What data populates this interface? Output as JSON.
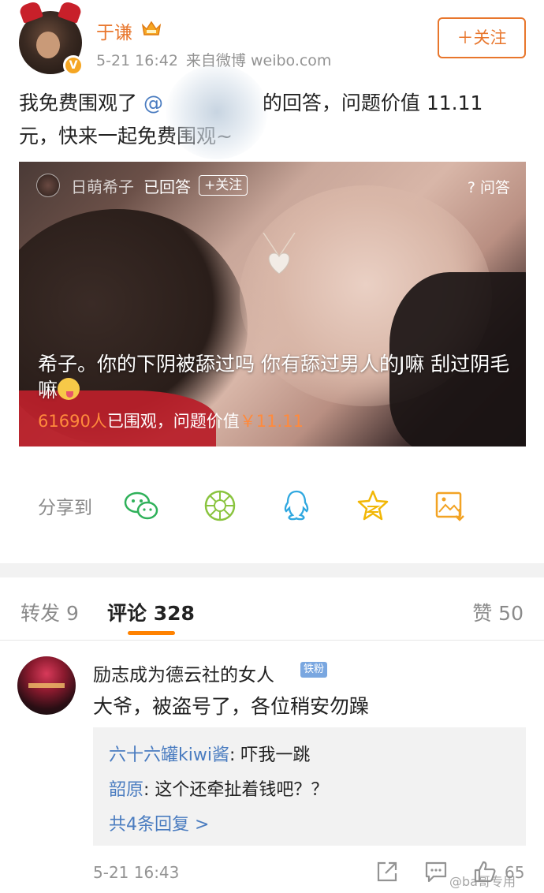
{
  "post": {
    "username": "于谦",
    "time": "5-21 16:42",
    "source": "来自微博 weibo.com",
    "follow_label": "＋关注",
    "text_before": "我免费围观了 ",
    "mention": "@",
    "text_after": " 的回答，问题价值 11.11 元，快来一起免费围观~"
  },
  "card": {
    "name": "日萌希子",
    "answered": "已回答",
    "follow": "+关注",
    "ask": "? 问答",
    "question": "希子。你的下阴被舔过吗  你有舔过男人的J嘛 刮过阴毛嘛",
    "viewers": "61690人",
    "viewers_suffix": "已围观，问题价值",
    "price": "￥11.11"
  },
  "share": {
    "label": "分享到",
    "targets": [
      "wechat-icon",
      "moments-icon",
      "qq-icon",
      "qzone-icon",
      "save-image-icon"
    ]
  },
  "tabs": {
    "repost": "转发 9",
    "comment": "评论 328",
    "like": "赞 50"
  },
  "comment": {
    "name": "励志成为德云社的女人",
    "badge": "铁粉",
    "text": "大爷，被盗号了，各位稍安勿躁",
    "replies": [
      {
        "name": "六十六罐kiwi酱",
        "text": ": 吓我一跳"
      },
      {
        "name": "韶原",
        "text": ": 这个还牵扯着钱吧？？"
      }
    ],
    "more": "共4条回复 >",
    "time": "5-21 16:43",
    "likes": "65"
  },
  "watermark": "@ba哥专用",
  "colors": {
    "accent": "#ff8200",
    "name_orange": "#e8762c",
    "link_blue": "#4a7cc0"
  }
}
